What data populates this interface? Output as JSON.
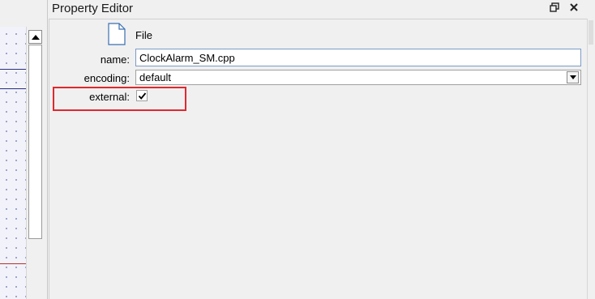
{
  "panel": {
    "title": "Property Editor",
    "restore_icon": "restore-window-icon",
    "close_icon": "close-icon"
  },
  "file": {
    "type_label": "File",
    "icon": "file-document-icon"
  },
  "fields": {
    "name_label": "name:",
    "name_value": "ClockAlarm_SM.cpp",
    "encoding_label": "encoding:",
    "encoding_value": "default",
    "external_label": "external:",
    "external_checked": true
  },
  "colors": {
    "highlight": "#e0282f"
  }
}
